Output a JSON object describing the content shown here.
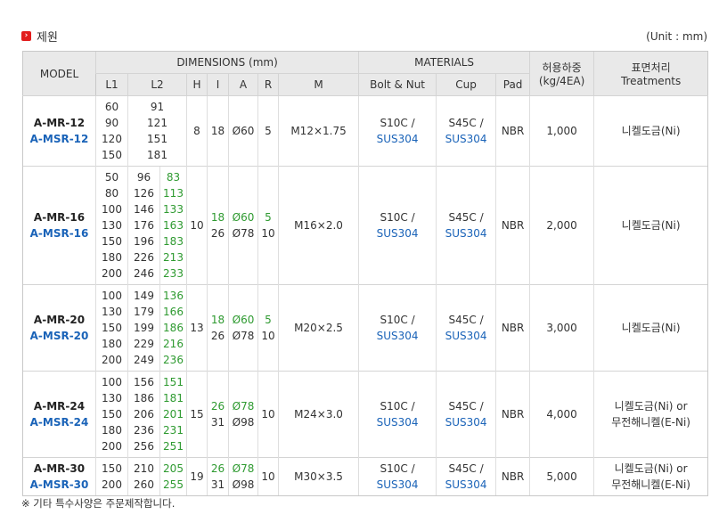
{
  "section": {
    "icon": "chevron-right-icon",
    "title": "제원",
    "unit": "(Unit : mm)"
  },
  "header": {
    "model": "MODEL",
    "dimensions": "DIMENSIONS (mm)",
    "materials": "MATERIALS",
    "load_line1": "허용하중",
    "load_line2": "(kg/4EA)",
    "treat_line1": "표면처리",
    "treat_line2": "Treatments",
    "l1": "L1",
    "l2": "L2",
    "h": "H",
    "i": "I",
    "a": "A",
    "r": "R",
    "m": "M",
    "bolt": "Bolt & Nut",
    "cup": "Cup",
    "pad": "Pad"
  },
  "rows": [
    {
      "model": "A-MR-12",
      "model_s": "A-MSR-12",
      "l1": [
        "60",
        "90",
        "120",
        "150"
      ],
      "l2a": [
        "91",
        "121",
        "151",
        "181"
      ],
      "l2b": [],
      "h": "8",
      "i": [
        "18"
      ],
      "a": [
        "Ø60"
      ],
      "r": [
        "5"
      ],
      "m": "M12×1.75",
      "bolt": "S10C /",
      "bolt_s": "SUS304",
      "cup": "S45C /",
      "cup_s": "SUS304",
      "pad": "NBR",
      "load": "1,000",
      "treat": [
        "니켈도금(Ni)"
      ]
    },
    {
      "model": "A-MR-16",
      "model_s": "A-MSR-16",
      "l1": [
        "50",
        "80",
        "100",
        "130",
        "150",
        "180",
        "200"
      ],
      "l2a": [
        "96",
        "126",
        "146",
        "176",
        "196",
        "226",
        "246"
      ],
      "l2b": [
        "83",
        "113",
        "133",
        "163",
        "183",
        "213",
        "233"
      ],
      "h": "10",
      "i": [
        "18",
        "26"
      ],
      "a": [
        "Ø60",
        "Ø78"
      ],
      "r": [
        "5",
        "10"
      ],
      "m": "M16×2.0",
      "bolt": "S10C /",
      "bolt_s": "SUS304",
      "cup": "S45C /",
      "cup_s": "SUS304",
      "pad": "NBR",
      "load": "2,000",
      "treat": [
        "니켈도금(Ni)"
      ]
    },
    {
      "model": "A-MR-20",
      "model_s": "A-MSR-20",
      "l1": [
        "100",
        "130",
        "150",
        "180",
        "200"
      ],
      "l2a": [
        "149",
        "179",
        "199",
        "229",
        "249"
      ],
      "l2b": [
        "136",
        "166",
        "186",
        "216",
        "236"
      ],
      "h": "13",
      "i": [
        "18",
        "26"
      ],
      "a": [
        "Ø60",
        "Ø78"
      ],
      "r": [
        "5",
        "10"
      ],
      "m": "M20×2.5",
      "bolt": "S10C /",
      "bolt_s": "SUS304",
      "cup": "S45C /",
      "cup_s": "SUS304",
      "pad": "NBR",
      "load": "3,000",
      "treat": [
        "니켈도금(Ni)"
      ]
    },
    {
      "model": "A-MR-24",
      "model_s": "A-MSR-24",
      "l1": [
        "100",
        "130",
        "150",
        "180",
        "200"
      ],
      "l2a": [
        "156",
        "186",
        "206",
        "236",
        "256"
      ],
      "l2b": [
        "151",
        "181",
        "201",
        "231",
        "251"
      ],
      "h": "15",
      "i": [
        "26",
        "31"
      ],
      "a": [
        "Ø78",
        "Ø98"
      ],
      "r": [
        "10"
      ],
      "m": "M24×3.0",
      "bolt": "S10C /",
      "bolt_s": "SUS304",
      "cup": "S45C /",
      "cup_s": "SUS304",
      "pad": "NBR",
      "load": "4,000",
      "treat": [
        "니켈도금(Ni) or",
        "무전해니켈(E-Ni)"
      ]
    },
    {
      "model": "A-MR-30",
      "model_s": "A-MSR-30",
      "l1": [
        "150",
        "200"
      ],
      "l2a": [
        "210",
        "260"
      ],
      "l2b": [
        "205",
        "255"
      ],
      "h": "19",
      "i": [
        "26",
        "31"
      ],
      "a": [
        "Ø78",
        "Ø98"
      ],
      "r": [
        "10"
      ],
      "m": "M30×3.5",
      "bolt": "S10C /",
      "bolt_s": "SUS304",
      "cup": "S45C /",
      "cup_s": "SUS304",
      "pad": "NBR",
      "load": "5,000",
      "treat": [
        "니켈도금(Ni) or",
        "무전해니켈(E-Ni)"
      ]
    }
  ],
  "footnote": "※ 기타 특수사양은 주문제작합니다."
}
